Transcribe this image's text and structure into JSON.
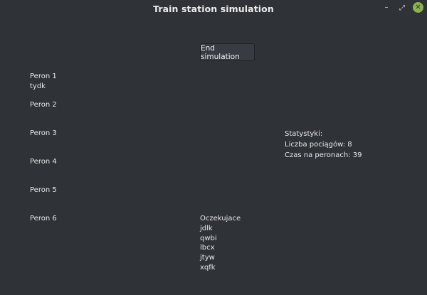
{
  "window": {
    "title": "Train station simulation",
    "controls": {
      "minimize": "–",
      "maximize": "⤢",
      "close": "✕"
    }
  },
  "toolbar": {
    "end_label": "End simulation"
  },
  "platforms": [
    {
      "label": "Peron 1",
      "train": "tydk"
    },
    {
      "label": "Peron 2",
      "train": ""
    },
    {
      "label": "Peron 3",
      "train": ""
    },
    {
      "label": "Peron 4",
      "train": ""
    },
    {
      "label": "Peron 5",
      "train": ""
    },
    {
      "label": "Peron 6",
      "train": ""
    }
  ],
  "queue": {
    "title": "Oczekujace",
    "items": [
      "jdlk",
      "qwbi",
      "lbcx",
      "jtyw",
      "xqfk"
    ]
  },
  "stats": {
    "title": "Statystyki:",
    "train_count": "Liczba pociągów: 8",
    "platform_time": "Czas na peronach: 39"
  }
}
